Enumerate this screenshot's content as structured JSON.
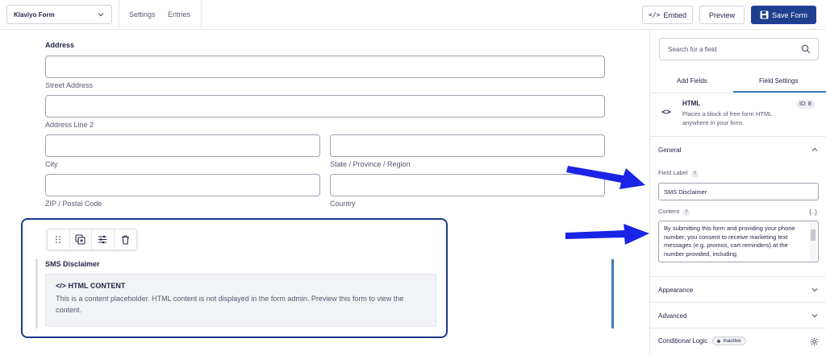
{
  "topbar": {
    "form_select": "Klaviyo Form",
    "links": [
      "Settings",
      "Entries"
    ],
    "embed_label": "Embed",
    "preview_label": "Preview",
    "save_label": "Save Form"
  },
  "address": {
    "title": "Address",
    "street_label": "Street Address",
    "line2_label": "Address Line 2",
    "city_label": "City",
    "state_label": "State / Province / Region",
    "zip_label": "ZIP / Postal Code",
    "country_label": "Country"
  },
  "html_field": {
    "name": "SMS Disclaimer",
    "placeholder_title": "</> HTML CONTENT",
    "placeholder_text": "This is a content placeholder. HTML content is not displayed in the form admin. Preview this form to view the content."
  },
  "sidebar": {
    "search_placeholder": "Search for a field",
    "tabs": [
      "Add Fields",
      "Field Settings"
    ],
    "active_tab": "Field Settings",
    "field_type": "HTML",
    "field_desc": "Places a block of free form HTML anywhere in your form.",
    "field_id": "ID: 8",
    "general_label": "General",
    "field_label_label": "Field Label",
    "field_label_value": "SMS Disclaimer",
    "content_label": "Content",
    "content_value": "By submitting this form and providing your phone number, you consent to receive marketing text messages (e.g. promos, cart reminders) at the number provided, including",
    "appearance_label": "Appearance",
    "advanced_label": "Advanced",
    "conditional_label": "Conditional Logic",
    "conditional_status": "Inactive"
  },
  "colors": {
    "primary": "#1e3f8e",
    "arrow": "#1a24e6",
    "highlight_border": "#1b3a8c",
    "active_tab": "#3e7eb6"
  }
}
